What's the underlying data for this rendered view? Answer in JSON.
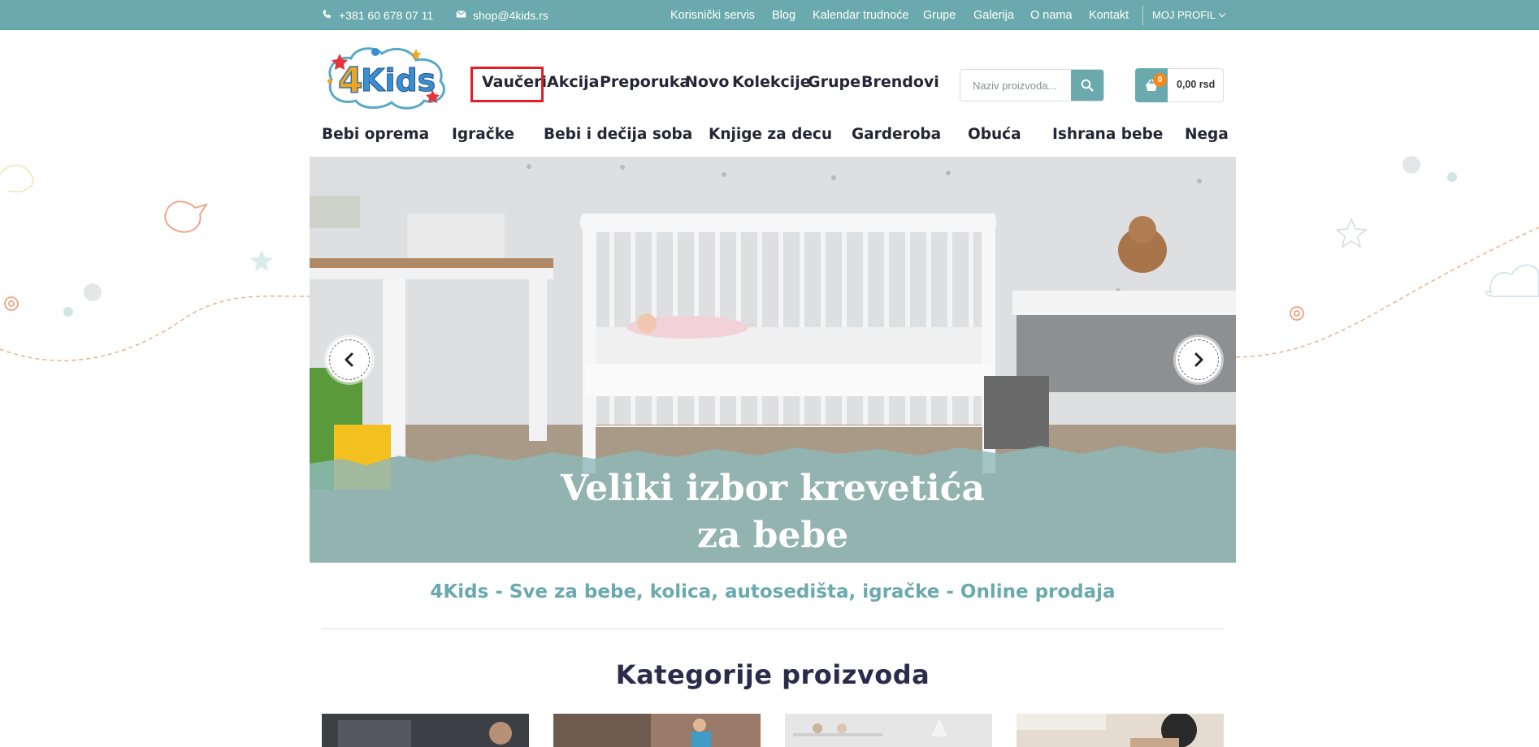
{
  "topbar": {
    "phone": "+381 60 678 07 11",
    "email": "shop@4kids.rs",
    "links": [
      "Korisnički servis",
      "Blog",
      "Kalendar trudnoće",
      "Grupe",
      "Galerija",
      "O nama",
      "Kontakt"
    ],
    "profile": "MOJ PROFIL"
  },
  "header": {
    "logo_text": "4Kids",
    "nav": [
      "Vaučeri",
      "Akcija",
      "Preporuka",
      "Novo",
      "Kolekcije",
      "Grupe",
      "Brendovi"
    ],
    "search_placeholder": "Naziv proizvoda...",
    "cart_count": "0",
    "cart_total": "0,00 rsd"
  },
  "categories_nav": [
    "Bebi oprema",
    "Igračke",
    "Bebi i dečija soba",
    "Knjige za decu",
    "Garderoba",
    "Obuća",
    "Ishrana bebe",
    "Nega"
  ],
  "hero": {
    "caption_line1": "Veliki izbor krevetića",
    "caption_line2": "za bebe"
  },
  "tagline": "4Kids - Sve za bebe, kolica, autosedišta, igračke - Online prodaja",
  "section_title": "Kategorije proizvoda",
  "colors": {
    "accent": "#6aa9ad",
    "highlight": "#e01f26",
    "badge": "#f08a1d",
    "heading": "#2b2b4b"
  },
  "icons": [
    "phone-icon",
    "envelope-icon",
    "search-icon",
    "cart-icon",
    "chevron-left-icon",
    "chevron-right-icon",
    "chevron-down-icon"
  ]
}
